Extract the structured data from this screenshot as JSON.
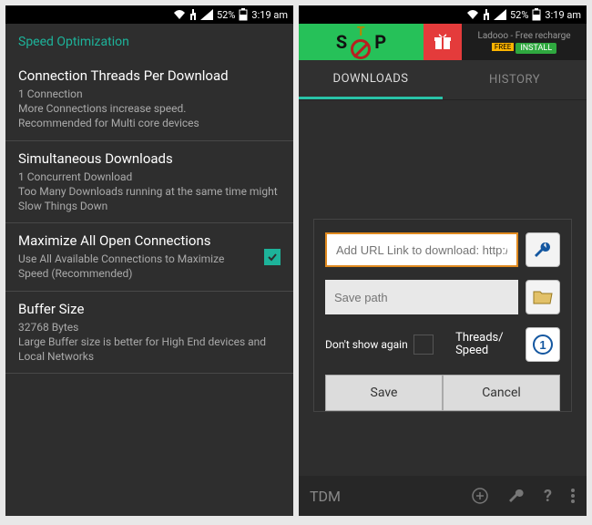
{
  "status_bar": {
    "battery": "52%",
    "time": "3:19 am"
  },
  "left": {
    "section_header": "Speed Optimization",
    "settings": [
      {
        "title": "Connection Threads Per Download",
        "desc": "1 Connection\nMore Connections increase speed.\nRecommended for Multi core devices"
      },
      {
        "title": "Simultaneous Downloads",
        "desc": "1 Concurrent Download\nToo Many Downloads running at the same time might Slow Things Down"
      },
      {
        "title": "Maximize All Open Connections",
        "desc": "Use All Available Connections to Maximize Speed (Recommended)",
        "checked": true
      },
      {
        "title": "Buffer Size",
        "desc": "32768 Bytes\nLarge Buffer size is better for High End devices and Local Networks"
      }
    ]
  },
  "right": {
    "ad": {
      "text": "Ladooo - Free recharge",
      "free": "FREE",
      "btn": "INSTALL"
    },
    "tabs": {
      "downloads": "DOWNLOADS",
      "history": "HISTORY"
    },
    "dialog": {
      "url_placeholder": "Add URL Link to download: http://..",
      "path_placeholder": "Save path",
      "dont_show": "Don't show again",
      "threads": "Threads/\nSpeed",
      "save": "Save",
      "cancel": "Cancel"
    },
    "bottom": {
      "brand": "TDM"
    }
  }
}
